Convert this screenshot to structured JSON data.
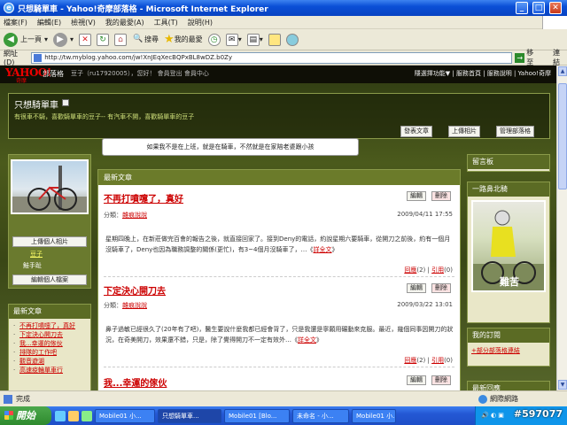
{
  "window": {
    "title": "只想騎單車 - Yahoo!奇摩部落格 - Microsoft Internet Explorer",
    "min": "_",
    "max": "□",
    "close": "✕"
  },
  "menu": [
    "檔案(F)",
    "編輯(E)",
    "檢視(V)",
    "我的最愛(A)",
    "工具(T)",
    "說明(H)"
  ],
  "toolbar": {
    "back": "上一頁",
    "search": "搜尋",
    "favorites": "我的最愛"
  },
  "address": {
    "label": "網址(D)",
    "url": "http://tw.myblog.yahoo.com/jw!XnJEqXecBQPxBL8wDZ.b0Zy",
    "go": "移至",
    "links": "連結"
  },
  "yahoo": {
    "logo": "YAHOO!",
    "logo_sub": "奇摩",
    "section": "部落格",
    "user": "豆子（ru17920005），您好！ 會員登出 會員中心",
    "nav": "隱選擇功能▼ | 服務首頁 | 服務說明 | Yahoo!奇摩"
  },
  "blog": {
    "title": "只想騎單車",
    "desc": "有很車不騎，喜歡騎單車的豆子-- 有汽車不開，喜歡騎單車的豆子",
    "btn_post": "發表文章",
    "btn_photo": "上傳相片",
    "btn_manage": "管理部落格",
    "tagline": "如果我不是在上班，就是在騎車，不然就是在家陪老婆跟小孩"
  },
  "profile": {
    "upload": "上傳個人相片",
    "name": "豆子",
    "level": "鮭手趾",
    "edit": "編輯個人檔案"
  },
  "latest": {
    "header": "最新文章",
    "items": [
      "不再打噴嚏了，真好",
      "下定決心開刀去",
      "我...幸運的傢伙",
      "排隊的工作吧",
      "觀音遊湖",
      "高速疫輪單車行"
    ]
  },
  "center": {
    "header": "最新文章",
    "edit": "編輯",
    "del": "刪除",
    "posts": [
      {
        "title": "不再打噴嚏了，真好",
        "cat_label": "分類：",
        "cat": "雜痕說說",
        "date": "2009/04/11 17:55",
        "body": "星期四晚上，在新莊做完百會的報告之後，就直接回家了。接到Deny的電話，約說星期六要騎車，從開刀之前後，約有一個月沒騎車了，Deny也因為職務調整的關係(更忙)，有3~4個月沒騎車了，…",
        "more": "詳全文",
        "foot_a": "回應",
        "foot_a_n": "(2)",
        "foot_b": "引用",
        "foot_b_n": "(0)"
      },
      {
        "title": "下定決心開刀去",
        "cat_label": "分類：",
        "cat": "雜痕說說",
        "date": "2009/03/22 13:01",
        "body": "鼻子過敏已經很久了(20年有了吧)，醫生要說什麼我都已經會背了，只是我還是寧願用碾動來克服。最近，幾個同事因開刀的狀況，在奇美開刀，效果還不錯，只是，除了覺得開刀不一定有效外…",
        "more": "詳全文",
        "foot_a": "回應",
        "foot_a_n": "(2)",
        "foot_b": "引用",
        "foot_b_n": "(0)"
      },
      {
        "title": "我...幸運的傢伙"
      }
    ]
  },
  "right": {
    "guestbook": "留言板",
    "trip": "一路鼻北騎",
    "photo_caption": "難苦",
    "subscribe": "我的訂閱",
    "subscribe_item": "+部分部落格連結",
    "friends": "最新回應"
  },
  "status": {
    "text": "完成",
    "zone": "網際網路"
  },
  "taskbar": {
    "start": "開始",
    "tasks": [
      "Mobile01 小...",
      "只想騎單車...",
      "Mobile01 [Blo...",
      "未命名 - 小...",
      "Mobile01 小..."
    ],
    "watermark": "#597077"
  }
}
